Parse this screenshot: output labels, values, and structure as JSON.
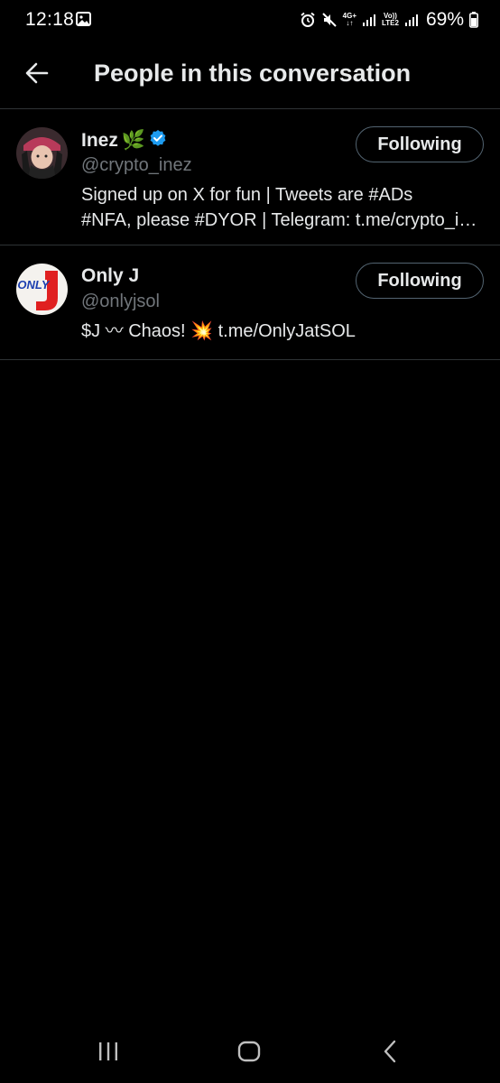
{
  "status_bar": {
    "time": "12:18",
    "network_label_top": "4G+",
    "volte_label_top": "Vo))",
    "volte_label_bottom": "LTE2",
    "battery_percent": "69%",
    "icons": [
      "gallery-icon",
      "alarm-icon",
      "mute-icon",
      "signal-icon",
      "battery-icon"
    ]
  },
  "header": {
    "title": "People in this conversation",
    "back_icon": "arrow-left-icon"
  },
  "users": [
    {
      "name": "Inez",
      "emoji": "🌿",
      "verified": true,
      "handle": "@crypto_inez",
      "bio_line1": "Signed up on X for fun | Tweets are #ADs",
      "bio_line2": "#NFA, please #DYOR | Telegram: t.me/crypto_inez",
      "follow_label": "Following"
    },
    {
      "name": "Only J",
      "emoji": "",
      "verified": false,
      "handle": "@onlyjsol",
      "bio_line1": "$J 〰 Chaos! 💥 t.me/OnlyJatSOL",
      "follow_label": "Following",
      "avatar_text": "ONLY",
      "avatar_letter": "J"
    }
  ],
  "colors": {
    "background": "#000000",
    "primary_text": "#e7e9ea",
    "secondary_text": "#71767b",
    "divider": "#2f3336",
    "verified_blue": "#1d9bf0",
    "button_border": "#536471"
  },
  "nav_bar": {
    "icons": [
      "recent-apps-icon",
      "home-icon",
      "back-icon"
    ]
  }
}
